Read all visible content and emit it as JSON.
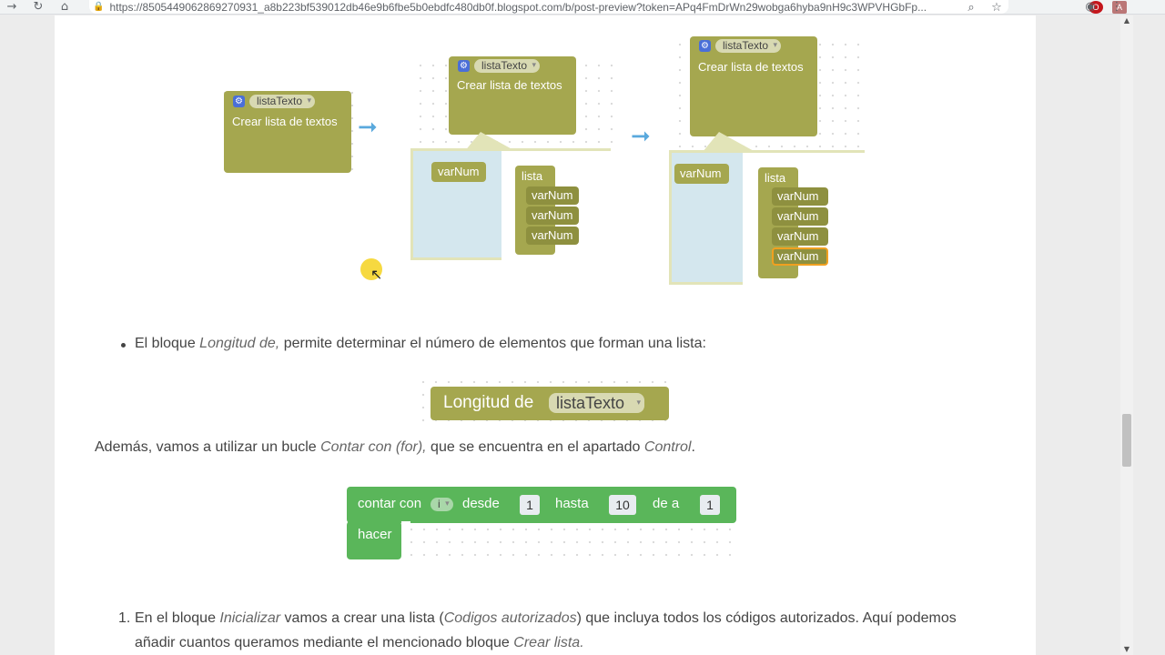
{
  "browser": {
    "url": "https://8505449062869270931_a8b223bf539012db46e9b6fbe5b0ebdfc480db0f.blogspot.com/b/post-preview?token=APq4FmDrWn29wobga6hyba9nH9c3WPVHGbFp..."
  },
  "figure1": {
    "block1": {
      "var": "listaTexto",
      "label": "Crear lista de textos"
    },
    "block2": {
      "var": "listaTexto",
      "label": "Crear lista de textos",
      "item": "varNum",
      "list": "lista",
      "items": [
        "varNum",
        "varNum",
        "varNum"
      ]
    },
    "block3": {
      "var": "listaTexto",
      "label": "Crear lista de textos",
      "item": "varNum",
      "list": "lista",
      "items": [
        "varNum",
        "varNum",
        "varNum",
        "varNum"
      ]
    }
  },
  "bullet1": {
    "pre": "El bloque ",
    "italic": "Longitud de,",
    "post": " permite determinar el número de elementos que forman una lista:"
  },
  "longitud_block": {
    "label": "Longitud de",
    "var": "listaTexto"
  },
  "para1": {
    "pre": "Además, vamos a utilizar un bucle ",
    "italic1": "Contar con (for),",
    "mid": " que se encuentra en el apartado ",
    "italic2": "Control",
    "post": "."
  },
  "loop_block": {
    "label_count": "contar con",
    "var": "i",
    "label_from": "desde",
    "from": "1",
    "label_to": "hasta",
    "to": "10",
    "label_by": "de a",
    "by": "1",
    "label_do": "hacer"
  },
  "step1": {
    "number": "1.",
    "line1_pre": "En el bloque ",
    "line1_italic": "Inicializar",
    "line1_mid": " vamos a crear una lista (",
    "line1_italic2": "Codigos autorizados",
    "line1_post": ") que incluya todos los códigos autorizados. Aquí podemos",
    "line2_pre": "añadir cuantos queramos mediante el mencionado bloque ",
    "line2_italic": "Crear lista."
  }
}
